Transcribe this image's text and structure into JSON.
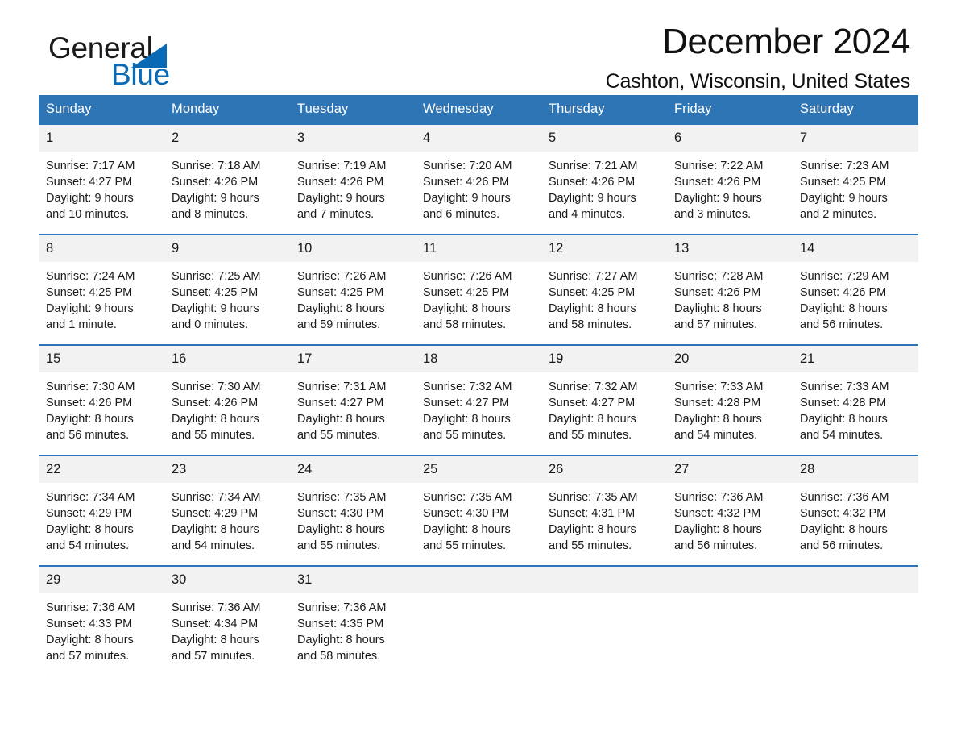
{
  "brand": {
    "word_one": "General",
    "word_two": "Blue",
    "triangle_color": "#0a69b4",
    "icon": "triangle-flag-icon"
  },
  "header": {
    "title": "December 2024",
    "subtitle": "Cashton, Wisconsin, United States"
  },
  "theme": {
    "header_blue": "#2e75b6",
    "daynum_bg": "#f2f2f2",
    "text": "#1a1a1a",
    "brand_blue": "#0a69b4"
  },
  "calendar": {
    "weekday_headers": [
      "Sunday",
      "Monday",
      "Tuesday",
      "Wednesday",
      "Thursday",
      "Friday",
      "Saturday"
    ],
    "weeks": [
      [
        {
          "day": "1",
          "sunrise": "Sunrise: 7:17 AM",
          "sunset": "Sunset: 4:27 PM",
          "daylight_1": "Daylight: 9 hours",
          "daylight_2": "and 10 minutes."
        },
        {
          "day": "2",
          "sunrise": "Sunrise: 7:18 AM",
          "sunset": "Sunset: 4:26 PM",
          "daylight_1": "Daylight: 9 hours",
          "daylight_2": "and 8 minutes."
        },
        {
          "day": "3",
          "sunrise": "Sunrise: 7:19 AM",
          "sunset": "Sunset: 4:26 PM",
          "daylight_1": "Daylight: 9 hours",
          "daylight_2": "and 7 minutes."
        },
        {
          "day": "4",
          "sunrise": "Sunrise: 7:20 AM",
          "sunset": "Sunset: 4:26 PM",
          "daylight_1": "Daylight: 9 hours",
          "daylight_2": "and 6 minutes."
        },
        {
          "day": "5",
          "sunrise": "Sunrise: 7:21 AM",
          "sunset": "Sunset: 4:26 PM",
          "daylight_1": "Daylight: 9 hours",
          "daylight_2": "and 4 minutes."
        },
        {
          "day": "6",
          "sunrise": "Sunrise: 7:22 AM",
          "sunset": "Sunset: 4:26 PM",
          "daylight_1": "Daylight: 9 hours",
          "daylight_2": "and 3 minutes."
        },
        {
          "day": "7",
          "sunrise": "Sunrise: 7:23 AM",
          "sunset": "Sunset: 4:25 PM",
          "daylight_1": "Daylight: 9 hours",
          "daylight_2": "and 2 minutes."
        }
      ],
      [
        {
          "day": "8",
          "sunrise": "Sunrise: 7:24 AM",
          "sunset": "Sunset: 4:25 PM",
          "daylight_1": "Daylight: 9 hours",
          "daylight_2": "and 1 minute."
        },
        {
          "day": "9",
          "sunrise": "Sunrise: 7:25 AM",
          "sunset": "Sunset: 4:25 PM",
          "daylight_1": "Daylight: 9 hours",
          "daylight_2": "and 0 minutes."
        },
        {
          "day": "10",
          "sunrise": "Sunrise: 7:26 AM",
          "sunset": "Sunset: 4:25 PM",
          "daylight_1": "Daylight: 8 hours",
          "daylight_2": "and 59 minutes."
        },
        {
          "day": "11",
          "sunrise": "Sunrise: 7:26 AM",
          "sunset": "Sunset: 4:25 PM",
          "daylight_1": "Daylight: 8 hours",
          "daylight_2": "and 58 minutes."
        },
        {
          "day": "12",
          "sunrise": "Sunrise: 7:27 AM",
          "sunset": "Sunset: 4:25 PM",
          "daylight_1": "Daylight: 8 hours",
          "daylight_2": "and 58 minutes."
        },
        {
          "day": "13",
          "sunrise": "Sunrise: 7:28 AM",
          "sunset": "Sunset: 4:26 PM",
          "daylight_1": "Daylight: 8 hours",
          "daylight_2": "and 57 minutes."
        },
        {
          "day": "14",
          "sunrise": "Sunrise: 7:29 AM",
          "sunset": "Sunset: 4:26 PM",
          "daylight_1": "Daylight: 8 hours",
          "daylight_2": "and 56 minutes."
        }
      ],
      [
        {
          "day": "15",
          "sunrise": "Sunrise: 7:30 AM",
          "sunset": "Sunset: 4:26 PM",
          "daylight_1": "Daylight: 8 hours",
          "daylight_2": "and 56 minutes."
        },
        {
          "day": "16",
          "sunrise": "Sunrise: 7:30 AM",
          "sunset": "Sunset: 4:26 PM",
          "daylight_1": "Daylight: 8 hours",
          "daylight_2": "and 55 minutes."
        },
        {
          "day": "17",
          "sunrise": "Sunrise: 7:31 AM",
          "sunset": "Sunset: 4:27 PM",
          "daylight_1": "Daylight: 8 hours",
          "daylight_2": "and 55 minutes."
        },
        {
          "day": "18",
          "sunrise": "Sunrise: 7:32 AM",
          "sunset": "Sunset: 4:27 PM",
          "daylight_1": "Daylight: 8 hours",
          "daylight_2": "and 55 minutes."
        },
        {
          "day": "19",
          "sunrise": "Sunrise: 7:32 AM",
          "sunset": "Sunset: 4:27 PM",
          "daylight_1": "Daylight: 8 hours",
          "daylight_2": "and 55 minutes."
        },
        {
          "day": "20",
          "sunrise": "Sunrise: 7:33 AM",
          "sunset": "Sunset: 4:28 PM",
          "daylight_1": "Daylight: 8 hours",
          "daylight_2": "and 54 minutes."
        },
        {
          "day": "21",
          "sunrise": "Sunrise: 7:33 AM",
          "sunset": "Sunset: 4:28 PM",
          "daylight_1": "Daylight: 8 hours",
          "daylight_2": "and 54 minutes."
        }
      ],
      [
        {
          "day": "22",
          "sunrise": "Sunrise: 7:34 AM",
          "sunset": "Sunset: 4:29 PM",
          "daylight_1": "Daylight: 8 hours",
          "daylight_2": "and 54 minutes."
        },
        {
          "day": "23",
          "sunrise": "Sunrise: 7:34 AM",
          "sunset": "Sunset: 4:29 PM",
          "daylight_1": "Daylight: 8 hours",
          "daylight_2": "and 54 minutes."
        },
        {
          "day": "24",
          "sunrise": "Sunrise: 7:35 AM",
          "sunset": "Sunset: 4:30 PM",
          "daylight_1": "Daylight: 8 hours",
          "daylight_2": "and 55 minutes."
        },
        {
          "day": "25",
          "sunrise": "Sunrise: 7:35 AM",
          "sunset": "Sunset: 4:30 PM",
          "daylight_1": "Daylight: 8 hours",
          "daylight_2": "and 55 minutes."
        },
        {
          "day": "26",
          "sunrise": "Sunrise: 7:35 AM",
          "sunset": "Sunset: 4:31 PM",
          "daylight_1": "Daylight: 8 hours",
          "daylight_2": "and 55 minutes."
        },
        {
          "day": "27",
          "sunrise": "Sunrise: 7:36 AM",
          "sunset": "Sunset: 4:32 PM",
          "daylight_1": "Daylight: 8 hours",
          "daylight_2": "and 56 minutes."
        },
        {
          "day": "28",
          "sunrise": "Sunrise: 7:36 AM",
          "sunset": "Sunset: 4:32 PM",
          "daylight_1": "Daylight: 8 hours",
          "daylight_2": "and 56 minutes."
        }
      ],
      [
        {
          "day": "29",
          "sunrise": "Sunrise: 7:36 AM",
          "sunset": "Sunset: 4:33 PM",
          "daylight_1": "Daylight: 8 hours",
          "daylight_2": "and 57 minutes."
        },
        {
          "day": "30",
          "sunrise": "Sunrise: 7:36 AM",
          "sunset": "Sunset: 4:34 PM",
          "daylight_1": "Daylight: 8 hours",
          "daylight_2": "and 57 minutes."
        },
        {
          "day": "31",
          "sunrise": "Sunrise: 7:36 AM",
          "sunset": "Sunset: 4:35 PM",
          "daylight_1": "Daylight: 8 hours",
          "daylight_2": "and 58 minutes."
        },
        {
          "day": "",
          "sunrise": "",
          "sunset": "",
          "daylight_1": "",
          "daylight_2": ""
        },
        {
          "day": "",
          "sunrise": "",
          "sunset": "",
          "daylight_1": "",
          "daylight_2": ""
        },
        {
          "day": "",
          "sunrise": "",
          "sunset": "",
          "daylight_1": "",
          "daylight_2": ""
        },
        {
          "day": "",
          "sunrise": "",
          "sunset": "",
          "daylight_1": "",
          "daylight_2": ""
        }
      ]
    ]
  }
}
